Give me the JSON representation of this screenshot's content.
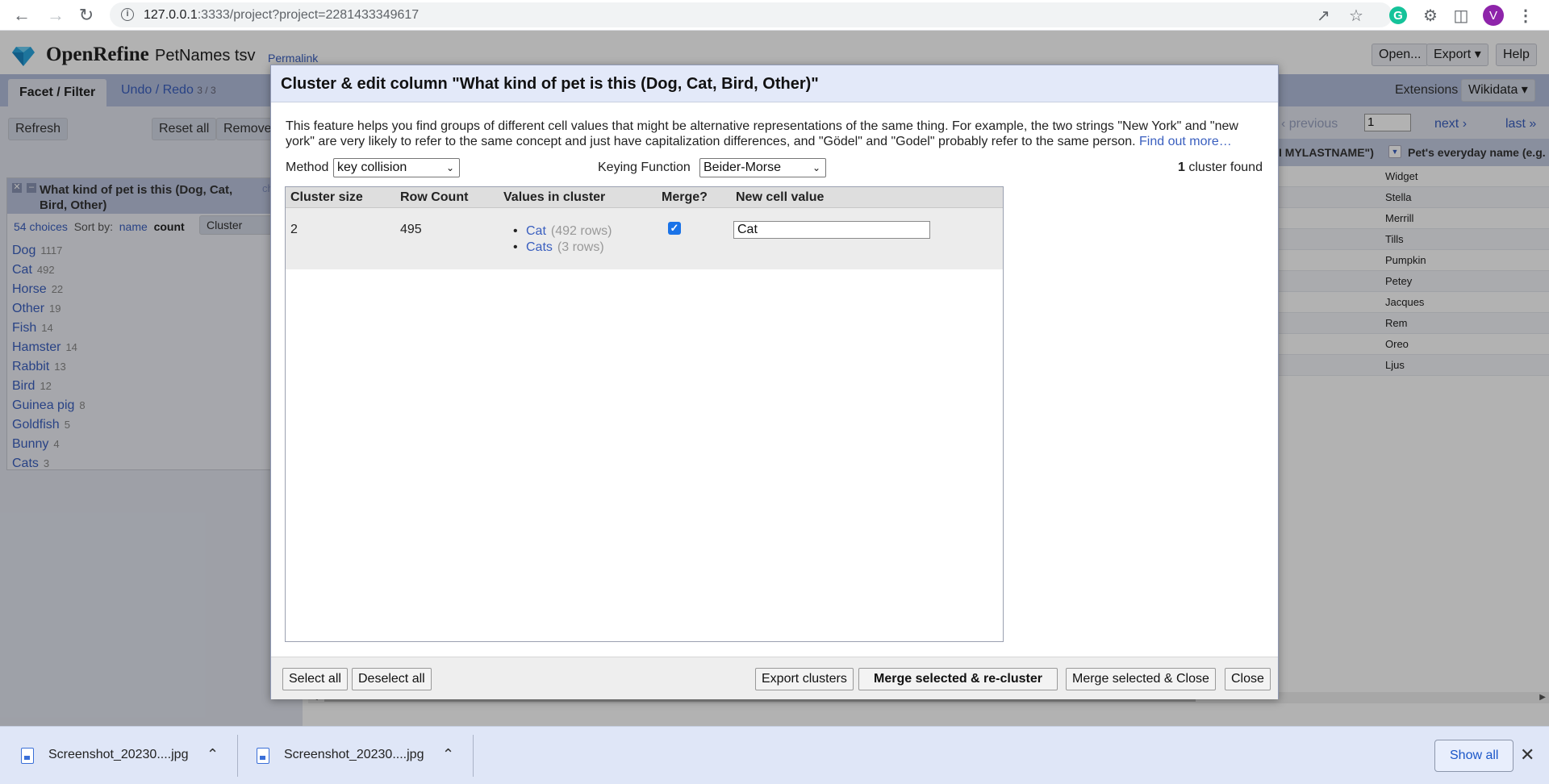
{
  "browser": {
    "url_host": "127.0.0.1",
    "url_rest": ":3333/project?project=2281433349617",
    "avatar_letter": "V",
    "grammarly_letter": "G"
  },
  "app": {
    "brand": "OpenRefine",
    "project_name": "PetNames tsv",
    "permalink": "Permalink",
    "header_buttons": {
      "open": "Open...",
      "export": "Export ▾",
      "help": "Help"
    },
    "tabs": {
      "facet": "Facet / Filter",
      "undo": "Undo / Redo",
      "undo_count": "3 / 3"
    },
    "left_buttons": {
      "refresh": "Refresh",
      "reset_all": "Reset all",
      "remove": "Remove"
    },
    "facet": {
      "title": "What kind of pet is this (Dog, Cat, Bird, Other)",
      "change": "change",
      "choices_count": "54 choices",
      "sort_by": "Sort by:",
      "sort_name": "name",
      "sort_count": "count",
      "cluster_btn": "Cluster",
      "choices": [
        {
          "name": "Dog",
          "count": "1117"
        },
        {
          "name": "Cat",
          "count": "492"
        },
        {
          "name": "Horse",
          "count": "22"
        },
        {
          "name": "Other",
          "count": "19"
        },
        {
          "name": "Fish",
          "count": "14"
        },
        {
          "name": "Hamster",
          "count": "14"
        },
        {
          "name": "Rabbit",
          "count": "13"
        },
        {
          "name": "Bird",
          "count": "12"
        },
        {
          "name": "Guinea pig",
          "count": "8"
        },
        {
          "name": "Goldfish",
          "count": "5"
        },
        {
          "name": "Bunny",
          "count": "4"
        },
        {
          "name": "Cats",
          "count": "3"
        }
      ]
    },
    "extensions": "Extensions",
    "wikidata": "Wikidata ▾",
    "pager": {
      "previous": "‹ previous",
      "page": "1",
      "next": "next ›",
      "last": "last »"
    },
    "columns": {
      "col_a": "I MYLASTNAME\")",
      "col_b": "Pet's everyday name (e.g. \""
    },
    "rows": [
      "Widget",
      "Stella",
      "Merrill",
      "Tills",
      "Pumpkin",
      "Petey",
      "Jacques",
      "Rem",
      "Oreo",
      "Ljus"
    ]
  },
  "dialog": {
    "title": "Cluster & edit column \"What kind of pet is this (Dog, Cat, Bird, Other)\"",
    "description": "This feature helps you find groups of different cell values that might be alternative representations of the same thing. For example, the two strings \"New York\" and \"new york\" are very likely to refer to the same concept and just have capitalization differences, and \"Gödel\" and \"Godel\" probably refer to the same person.",
    "find_out_more": "Find out more…",
    "method_label": "Method",
    "method_value": "key collision",
    "keying_label": "Keying Function",
    "keying_value": "Beider-Morse",
    "found_count": "1",
    "found_text": "cluster found",
    "headers": {
      "size": "Cluster size",
      "rows": "Row Count",
      "values": "Values in cluster",
      "merge": "Merge?",
      "new_value": "New cell value"
    },
    "clusters": [
      {
        "size": "2",
        "row_count": "495",
        "values": [
          {
            "name": "Cat",
            "rows": "(492 rows)"
          },
          {
            "name": "Cats",
            "rows": "(3 rows)"
          }
        ],
        "merge": true,
        "new_value": "Cat"
      }
    ],
    "buttons": {
      "select_all": "Select all",
      "deselect_all": "Deselect all",
      "export": "Export clusters",
      "merge_recluster": "Merge selected & re-cluster",
      "merge_close": "Merge selected & Close",
      "close": "Close"
    }
  },
  "downloads": {
    "items": [
      {
        "name": "Screenshot_20230....jpg"
      },
      {
        "name": "Screenshot_20230....jpg"
      }
    ],
    "show_all": "Show all"
  }
}
